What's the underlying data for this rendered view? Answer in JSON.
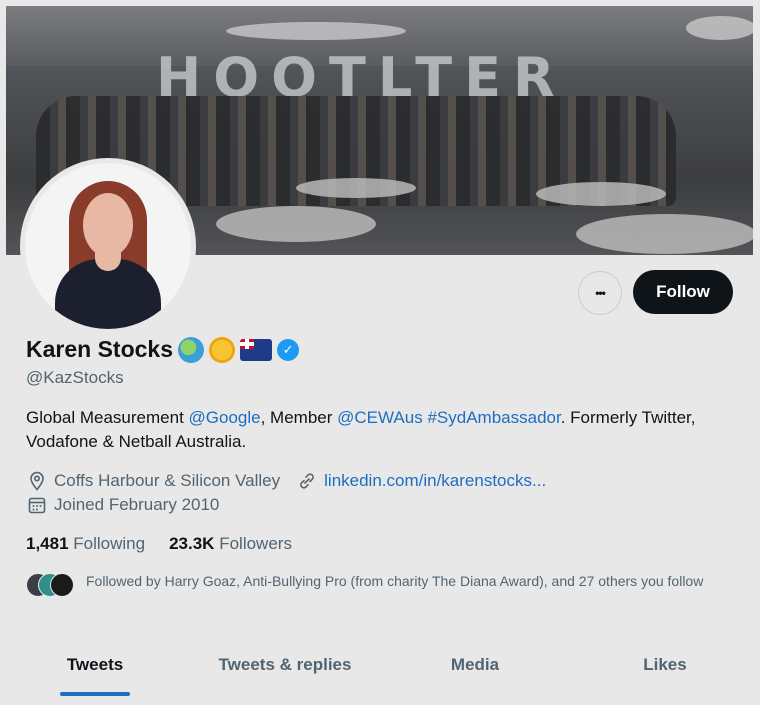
{
  "banner": {
    "caption": "",
    "balloon_text": "HOOTLTER"
  },
  "profile": {
    "name": "Karen Stocks",
    "handle": "@KazStocks",
    "badges": [
      "globe-emoji",
      "sun-emoji",
      "australia-flag-emoji",
      "verified-badge"
    ],
    "bio": {
      "part1": "Global Measurement ",
      "mention1": "@Google",
      "part2": ", Member ",
      "mention2": "@CEWAus",
      "part3": " ",
      "hashtag": "#SydAmbassador",
      "part4": ". Formerly Twitter, Vodafone & Netball Australia."
    },
    "location": "Coffs Harbour & Silicon Valley",
    "website": "linkedin.com/in/karenstocks...",
    "joined": "Joined February 2010",
    "following_count": "1,481",
    "following_label": "Following",
    "followers_count": "23.3K",
    "followers_label": "Followers",
    "followed_by": "Followed by Harry Goaz, Anti-Bullying Pro (from charity The Diana Award), and 27 others you follow"
  },
  "actions": {
    "more_label": "•••",
    "follow_label": "Follow"
  },
  "tabs": [
    {
      "label": "Tweets",
      "active": true
    },
    {
      "label": "Tweets & replies",
      "active": false
    },
    {
      "label": "Media",
      "active": false
    },
    {
      "label": "Likes",
      "active": false
    }
  ],
  "colors": {
    "accent": "#1d6ec0",
    "verified": "#1d9bf0",
    "text": "#0f1419",
    "muted": "#536471",
    "background": "#e8e8e8"
  }
}
